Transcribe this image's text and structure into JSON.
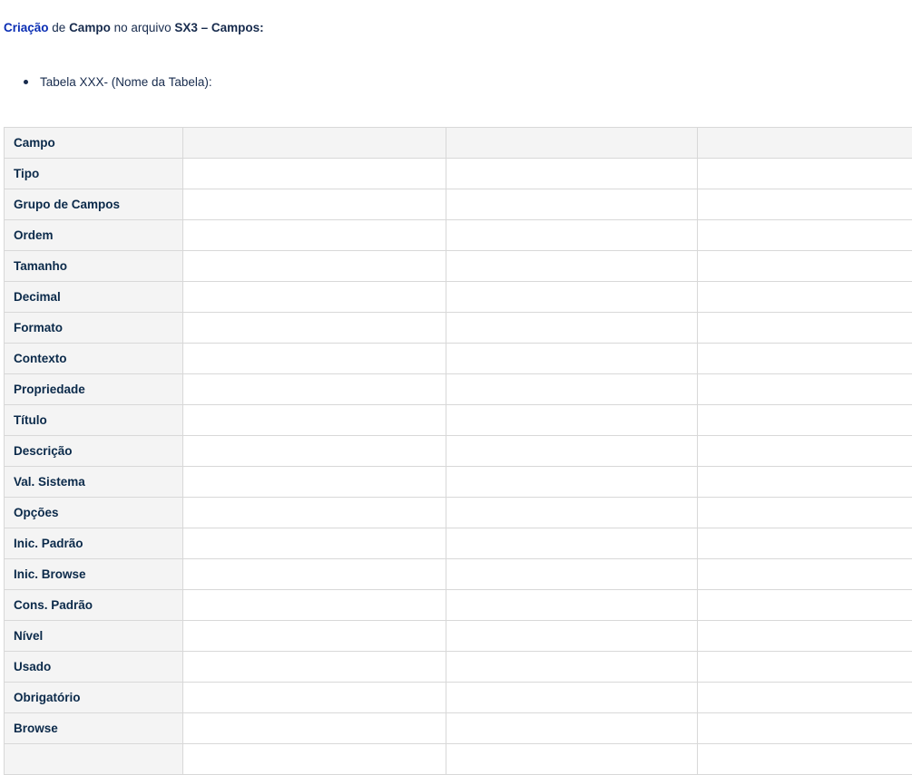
{
  "heading": {
    "part1": "Criação",
    "part2": " de ",
    "part3": "Campo",
    "part4": " no arquivo ",
    "part5": "SX3 – Campos:"
  },
  "bullets": [
    "Tabela XXX- (Nome da Tabela):"
  ],
  "table": {
    "rows": [
      "Campo",
      "Tipo",
      "Grupo de Campos",
      "Ordem",
      "Tamanho",
      "Decimal",
      "Formato",
      "Contexto",
      "Propriedade",
      "Título",
      "Descrição",
      "Val. Sistema",
      "Opções",
      "Inic. Padrão",
      "Inic. Browse",
      "Cons. Padrão",
      "Nível",
      "Usado",
      "Obrigatório",
      "Browse",
      ""
    ]
  }
}
